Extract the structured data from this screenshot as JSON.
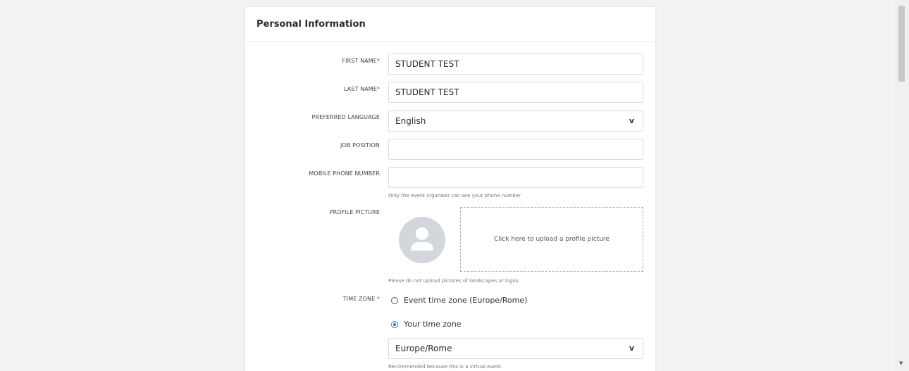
{
  "section": {
    "title": "Personal Information"
  },
  "fields": {
    "first_name": {
      "label": "FIRST NAME",
      "required": "*",
      "value": "STUDENT TEST"
    },
    "last_name": {
      "label": "LAST NAME",
      "required": "*",
      "value": "STUDENT TEST"
    },
    "language": {
      "label": "PREFERRED LANGUAGE",
      "value": "English"
    },
    "job_position": {
      "label": "JOB POSITION",
      "value": ""
    },
    "mobile_phone": {
      "label": "MOBILE PHONE NUMBER",
      "value": "",
      "help": "Only the event organiser can see your phone number"
    },
    "profile_picture": {
      "label": "PROFILE PICTURE",
      "upload_text": "Click here to upload a profile picture",
      "help": "Please do not upload pictures of landscapes or logos."
    },
    "time_zone": {
      "label": "TIME ZONE",
      "required": "*",
      "options": [
        {
          "label": "Event time zone (Europe/Rome)",
          "checked": false
        },
        {
          "label": "Your time zone",
          "checked": true
        }
      ],
      "selected_zone": "Europe/Rome",
      "help": "Recommended because this is a virtual event."
    }
  },
  "icons": {
    "dropdown": "chevron-down-icon",
    "avatar": "user-avatar-icon",
    "scroll_down": "scroll-down-arrow-icon"
  },
  "colors": {
    "required": "#e0245e",
    "radio_selected": "#2f6fd6",
    "page_bg": "#f2f2f2"
  }
}
